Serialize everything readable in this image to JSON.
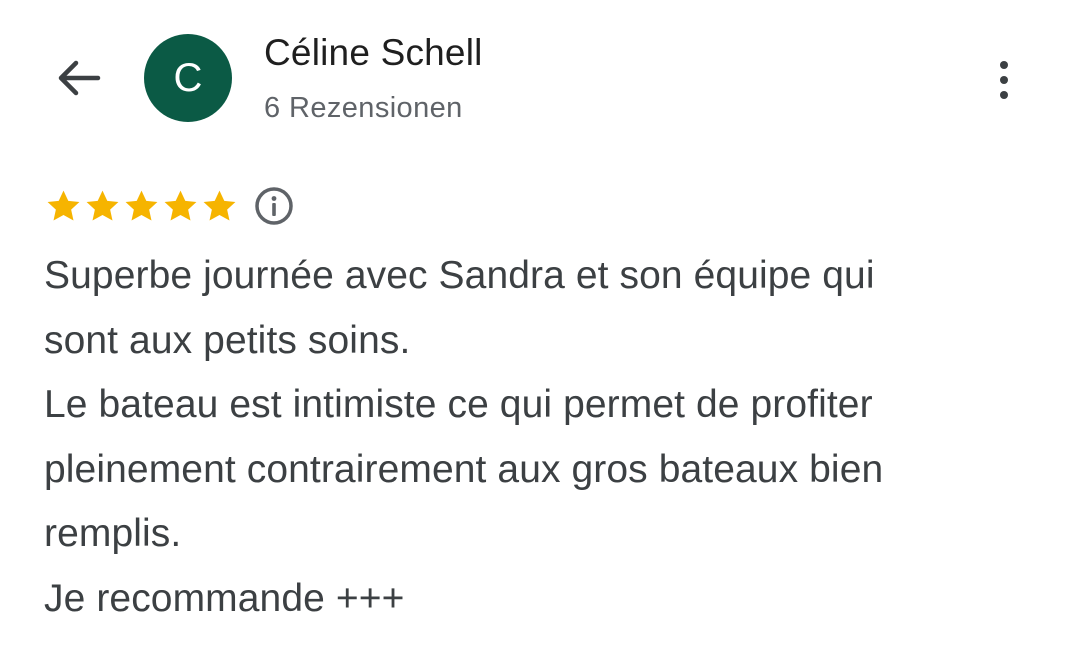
{
  "header": {
    "back_icon": "arrow-left-icon",
    "avatar_letter": "C",
    "avatar_color": "#0b5a45",
    "user_name": "Céline Schell",
    "review_count": "6 Rezensionen",
    "more_icon": "more-vertical-icon"
  },
  "review": {
    "rating": 5,
    "max_rating": 5,
    "star_color": "#f6b400",
    "info_icon": "info-icon",
    "lines": [
      "Superbe journée avec Sandra et son équipe qui",
      "sont aux petits soins.",
      "Le bateau est intimiste ce qui permet de profiter",
      "pleinement contrairement aux gros bateaux bien",
      "remplis.",
      "Je recommande +++"
    ]
  }
}
